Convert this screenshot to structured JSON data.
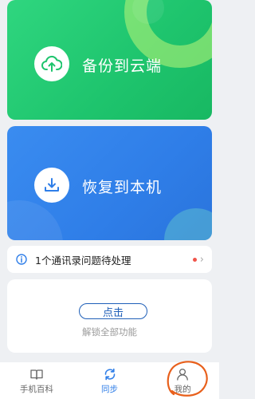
{
  "cards": {
    "backup": {
      "label": "备份到云端",
      "icon": "cloud-upload-icon",
      "color": "#1ec46d"
    },
    "restore": {
      "label": "恢复到本机",
      "icon": "download-tray-icon",
      "color": "#2f7ee8"
    }
  },
  "notice": {
    "text": "1个通讯录问题待处理",
    "icon": "info-icon",
    "dot_color": "#f0544a"
  },
  "unlock": {
    "button_label": "点击",
    "caption": "解锁全部功能"
  },
  "tabs": [
    {
      "label": "手机百科",
      "icon": "book-icon",
      "active": false
    },
    {
      "label": "同步",
      "icon": "sync-icon",
      "active": true
    },
    {
      "label": "我的",
      "icon": "user-icon",
      "active": false
    }
  ],
  "accent": "#2f7ee8",
  "annotation_color": "#e8601c"
}
